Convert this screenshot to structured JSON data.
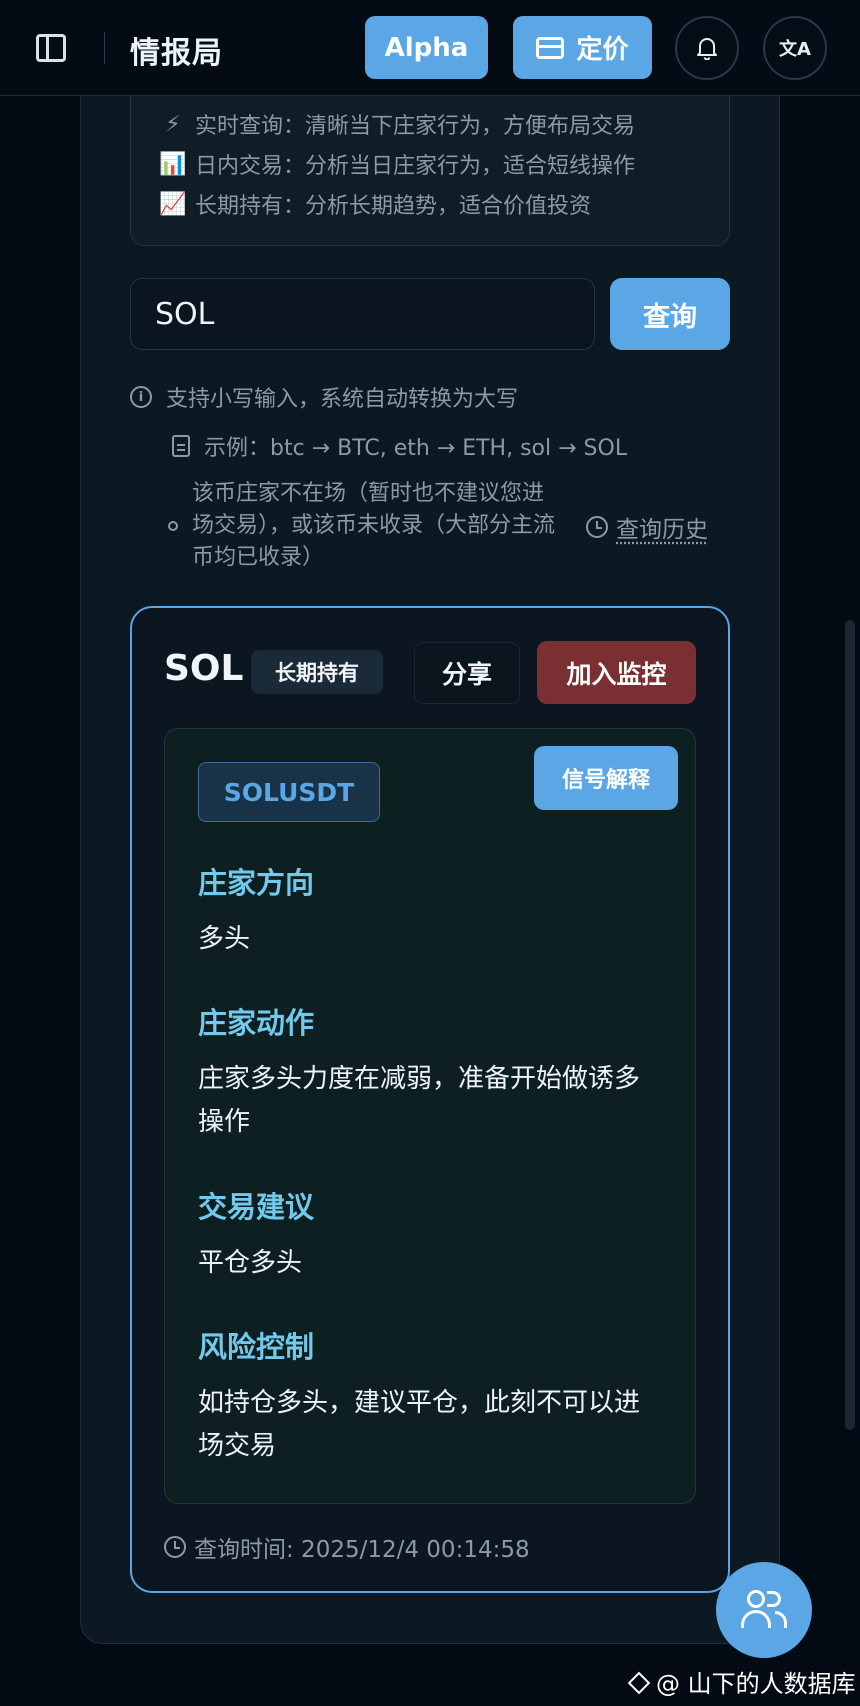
{
  "header": {
    "title": "情报局",
    "alpha_label": "Alpha",
    "pricing_label": "定价",
    "language_glyph": "文A"
  },
  "modes": [
    {
      "emoji": "⚡",
      "text": "实时查询：清晰当下庄家行为，方便布局交易"
    },
    {
      "emoji": "📊",
      "text": "日内交易：分析当日庄家行为，适合短线操作"
    },
    {
      "emoji": "📈",
      "text": "长期持有：分析长期趋势，适合价值投资"
    }
  ],
  "search": {
    "value": "SOL",
    "button_label": "查询"
  },
  "hints": {
    "lowercase": "支持小写输入，系统自动转换为大写",
    "example": "示例：btc → BTC, eth → ETH, sol → SOL",
    "not_present": "该币庄家不在场（暂时也不建议您进场交易），或该币未收录（大部分主流币均已收录）",
    "history_label": "查询历史"
  },
  "result": {
    "symbol": "SOL",
    "term_badge": "长期持有",
    "share_label": "分享",
    "monitor_label": "加入监控",
    "pair": "SOLUSDT",
    "explain_label": "信号解释",
    "sections": [
      {
        "title": "庄家方向",
        "body": "多头"
      },
      {
        "title": "庄家动作",
        "body": "庄家多头力度在减弱，准备开始做诱多操作"
      },
      {
        "title": "交易建议",
        "body": "平仓多头"
      },
      {
        "title": "风险控制",
        "body": "如持仓多头，建议平仓，此刻不可以进场交易"
      }
    ],
    "query_time": "查询时间: 2025/12/4 00:14:58"
  },
  "watermark": "@ 山下的人数据库",
  "colors": {
    "accent": "#5ba6e4",
    "danger": "#7a2f33",
    "section_title": "#72c9ec",
    "background": "#030a13"
  }
}
